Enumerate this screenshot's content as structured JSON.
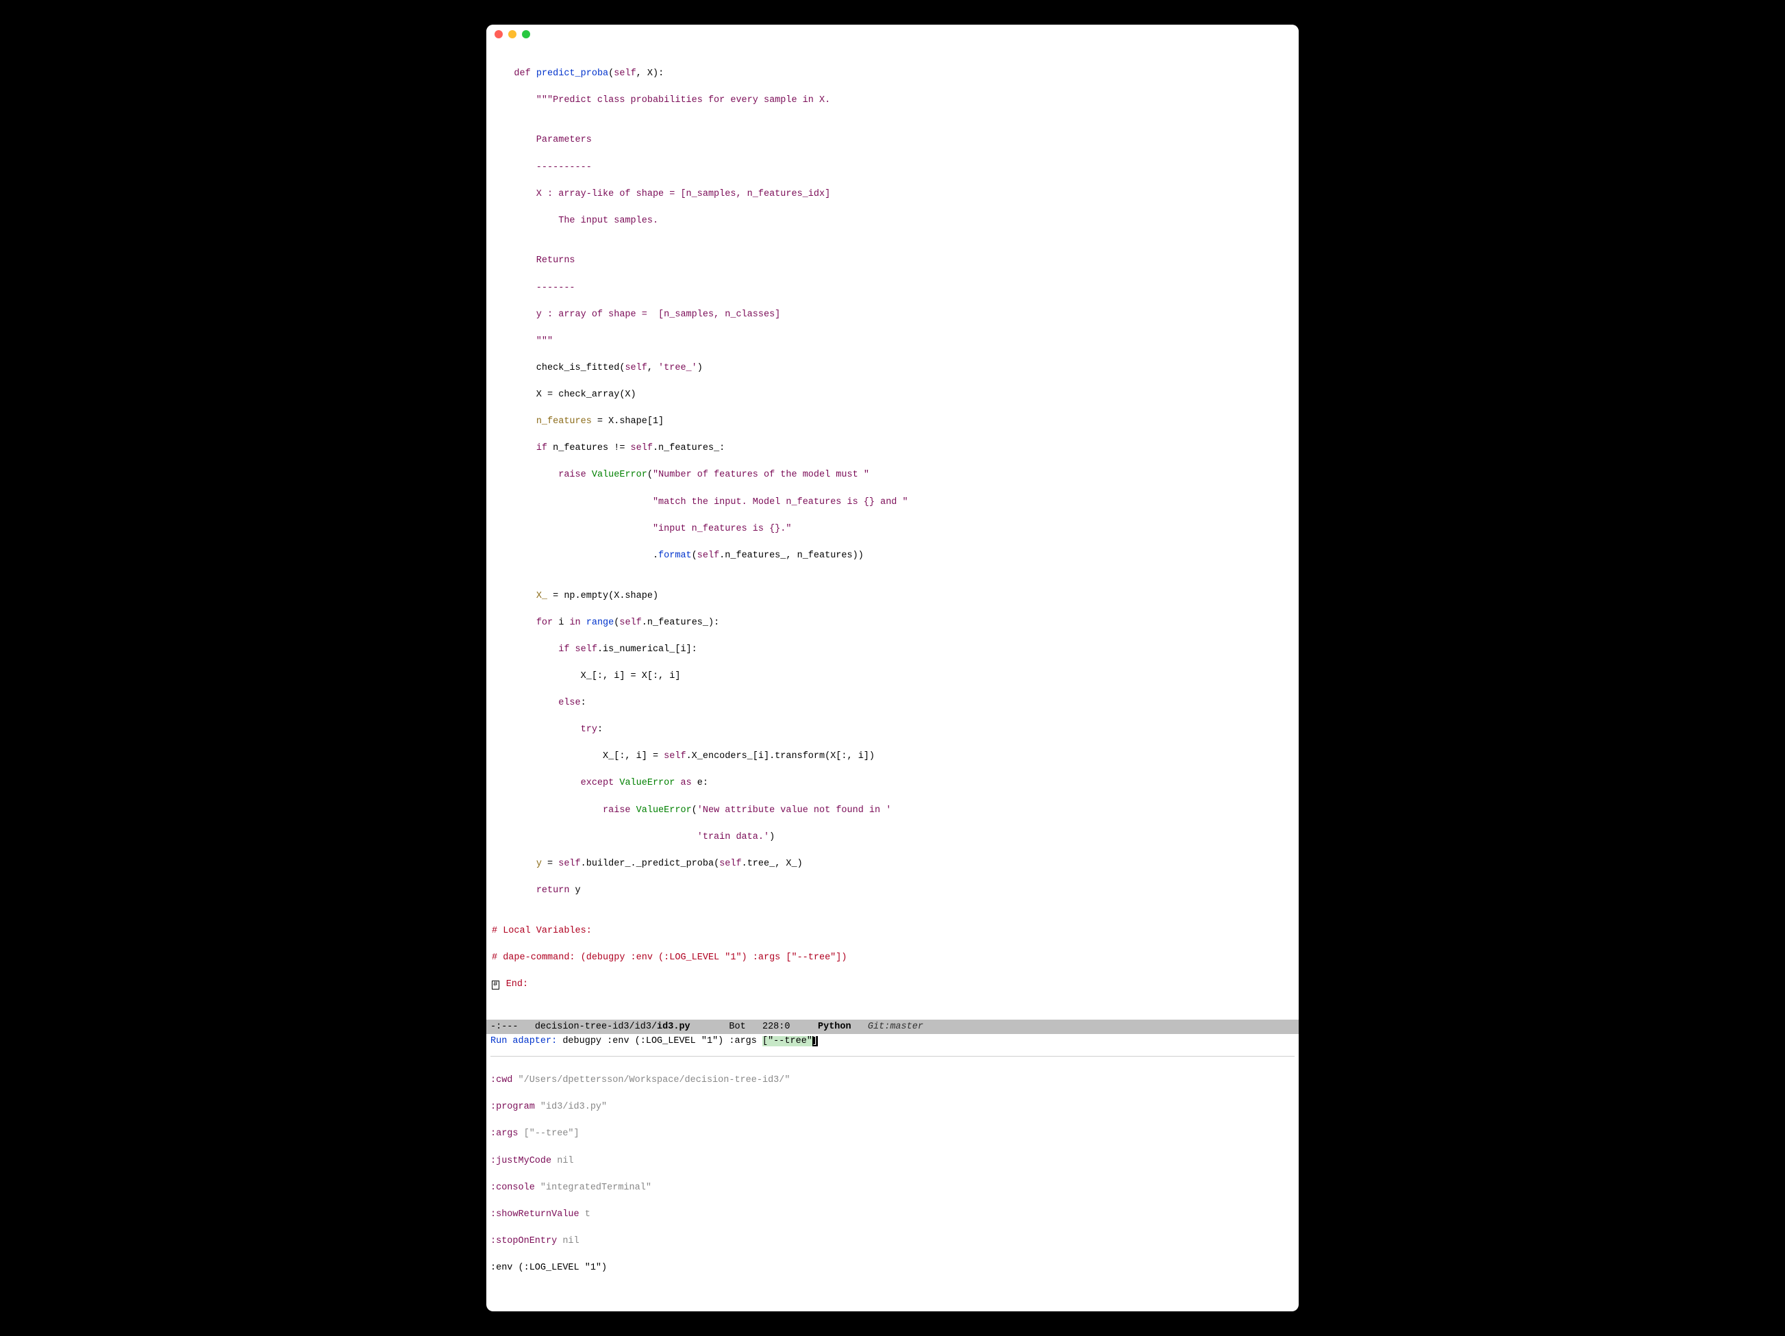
{
  "code": {
    "l1": "    def predict_proba(self, X):",
    "l2": "        \"\"\"Predict class probabilities for every sample in X.",
    "l3": "",
    "l4": "        Parameters",
    "l5": "        ----------",
    "l6": "        X : array-like of shape = [n_samples, n_features_idx]",
    "l7": "            The input samples.",
    "l8": "",
    "l9": "        Returns",
    "l10": "        -------",
    "l11": "        y : array of shape =  [n_samples, n_classes]",
    "l12": "        \"\"\"",
    "l13": "        check_is_fitted(self, 'tree_')",
    "l14": "        X = check_array(X)",
    "l15": "        n_features = X.shape[1]",
    "l16": "        if n_features != self.n_features_:",
    "l17": "            raise ValueError(\"Number of features of the model must \"",
    "l18": "                             \"match the input. Model n_features is {} and \"",
    "l19": "                             \"input n_features is {}.\"",
    "l20": "                             .format(self.n_features_, n_features))",
    "l21": "",
    "l22": "        X_ = np.empty(X.shape)",
    "l23": "        for i in range(self.n_features_):",
    "l24": "            if self.is_numerical_[i]:",
    "l25": "                X_[:, i] = X[:, i]",
    "l26": "            else:",
    "l27": "                try:",
    "l28": "                    X_[:, i] = self.X_encoders_[i].transform(X[:, i])",
    "l29": "                except ValueError as e:",
    "l30": "                    raise ValueError('New attribute value not found in '",
    "l31": "                                     'train data.')",
    "l32": "        y = self.builder_._predict_proba(self.tree_, X_)",
    "l33": "        return y",
    "l34": "",
    "c1": "# Local Variables:",
    "c2": "# dape-command: (debugpy :env (:LOG_LEVEL \"1\") :args [\"--tree\"])",
    "c3": "# End:"
  },
  "modeline": {
    "left": "-:---   ",
    "path": "decision-tree-id3/id3/",
    "file": "id3.py",
    "pos": "       Bot   228:0     ",
    "mode": "Python",
    "git": "   Git:master"
  },
  "minibuf": {
    "prompt": "Run adapter: ",
    "body1": "debugpy :env (:LOG_LEVEL \"1\") :args ",
    "hl": "[\"--tree\"",
    "cursor": "]"
  },
  "config": {
    "cwd_k": ":cwd",
    "cwd_v": " \"/Users/dpettersson/Workspace/decision-tree-id3/\"",
    "prog_k": ":program",
    "prog_v": " \"id3/id3.py\"",
    "args_k": ":args",
    "args_v": " [\"--tree\"]",
    "jmc_k": ":justMyCode",
    "jmc_v": " nil",
    "con_k": ":console",
    "con_v": " \"integratedTerminal\"",
    "srv_k": ":showReturnValue",
    "srv_v": " t",
    "soe_k": ":stopOnEntry",
    "soe_v": " nil",
    "env": ":env (:LOG_LEVEL \"1\")"
  }
}
